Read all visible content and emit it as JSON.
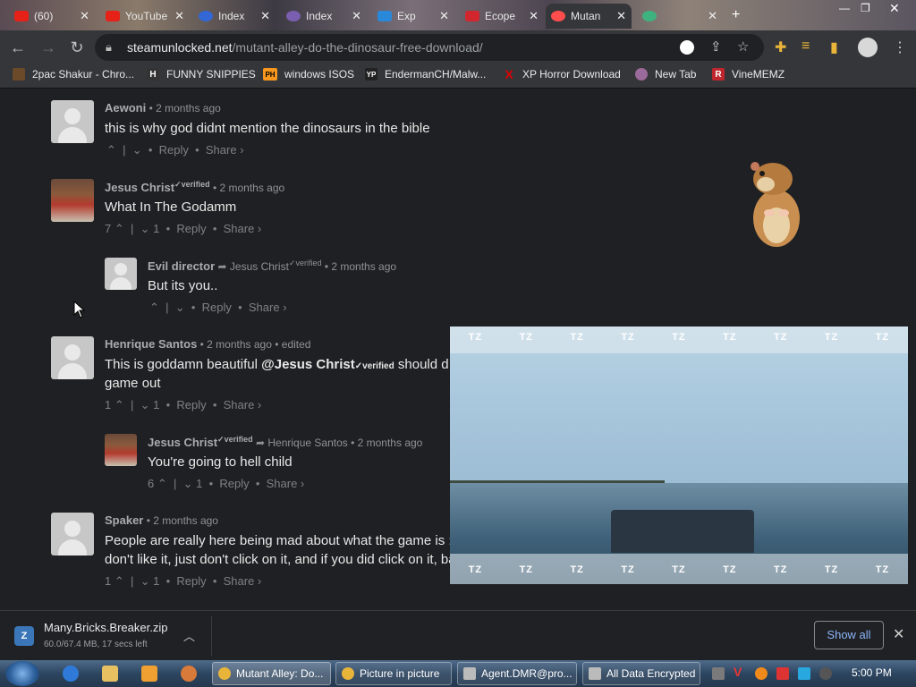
{
  "browser": {
    "tabs": [
      {
        "title": "(60)",
        "color": "#e62117",
        "active": false
      },
      {
        "title": "YouTube",
        "color": "#e62117",
        "active": false
      },
      {
        "title": "Index",
        "color": "#3367d6",
        "active": false
      },
      {
        "title": "Index",
        "color": "#7a5fb0",
        "active": false
      },
      {
        "title": "Exp",
        "color": "#2a88d8",
        "active": false
      },
      {
        "title": "Ecope",
        "color": "#d2262e",
        "active": false
      },
      {
        "title": "Mutan",
        "color": "#ff4d4d",
        "active": true
      }
    ],
    "url_host": "steamunlocked.net",
    "url_path": "/mutant-alley-do-the-dinosaur-free-download/",
    "bookmarks": [
      {
        "label": "2pac Shakur - Chro...",
        "icon": "tupac-icon",
        "color": "#6b4a2a",
        "glyph": ""
      },
      {
        "label": "FUNNY SNIPPIES",
        "icon": "h-icon",
        "color": "#333333",
        "glyph": "H"
      },
      {
        "label": "windows ISOS",
        "icon": "ph-icon",
        "color": "#f7971d",
        "glyph": "PH"
      },
      {
        "label": "EndermanCH/Malw...",
        "icon": "yp-icon",
        "color": "#222222",
        "glyph": "YP"
      },
      {
        "label": "XP Horror Download",
        "icon": "x-icon",
        "color": "#d00000",
        "glyph": "X"
      },
      {
        "label": "New Tab",
        "icon": "newtab-icon",
        "color": "#9a6a9a",
        "glyph": ""
      },
      {
        "label": "VineMEMZ",
        "icon": "vine-icon",
        "color": "#c0262d",
        "glyph": "R"
      }
    ]
  },
  "comments": [
    {
      "author": "Aewoni",
      "verified": "",
      "reply_to": "",
      "reply_verified": "",
      "time": "2 months ago",
      "edited": "",
      "text": "this is why god didnt mention the dinosaurs in the bible",
      "text2": "",
      "up": "",
      "down": "",
      "reply": "Reply",
      "share": "Share ›",
      "avatar": "default"
    },
    {
      "author": "Jesus Christ",
      "verified": "✓verified",
      "reply_to": "",
      "reply_verified": "",
      "time": "2 months ago",
      "edited": "",
      "text": "What In The Godamm",
      "text2": "",
      "up": "7",
      "down": "1",
      "reply": "Reply",
      "share": "Share ›",
      "avatar": "jesus"
    },
    {
      "author": "Evil director",
      "verified": "",
      "reply_to": "Jesus Christ",
      "reply_verified": "✓verified",
      "time": "2 months ago",
      "edited": "",
      "text": "But its you..",
      "text2": "",
      "up": "",
      "down": "",
      "reply": "Reply",
      "share": "Share ›",
      "avatar": "default"
    },
    {
      "author": "Henrique Santos",
      "verified": "",
      "reply_to": "",
      "reply_verified": "",
      "time": "2 months ago",
      "edited": "edited",
      "text_pre": "This is goddamn beautiful ",
      "mention": "@Jesus Christ",
      "mention_verified": "✓verified",
      "text_post": " should d",
      "text2": "game out",
      "up": "1",
      "down": "1",
      "reply": "Reply",
      "share": "Share ›",
      "avatar": "default"
    },
    {
      "author": "Jesus Christ",
      "verified": "✓verified",
      "reply_to": "Henrique Santos",
      "reply_verified": "",
      "time": "2 months ago",
      "edited": "",
      "text": "You're going to hell child",
      "text2": "",
      "up": "6",
      "down": "1",
      "reply": "Reply",
      "share": "Share ›",
      "avatar": "jesus"
    },
    {
      "author": "Spaker",
      "verified": "",
      "reply_to": "",
      "reply_verified": "",
      "time": "2 months ago",
      "edited": "",
      "text": "People are really here being mad about what the game is :",
      "text2": "don't like it, just don't click on it, and if you did click on it, ba",
      "up": "1",
      "down": "1",
      "reply": "Reply",
      "share": "Share ›",
      "avatar": "default"
    }
  ],
  "pip": {
    "watermark": "TZ"
  },
  "download": {
    "filename": "Many.Bricks.Breaker.zip",
    "status": "60.0/67.4 MB, 17 secs left",
    "show_all": "Show all",
    "progress": 0.89
  },
  "taskbar": {
    "tasks": [
      {
        "label": "Mutant Alley: Do...",
        "icon_color": "#e9b43a",
        "active": true
      },
      {
        "label": "Picture in picture",
        "icon_color": "#e9b43a",
        "active": false
      },
      {
        "label": "Agent.DMR@pro...",
        "icon_color": "#bbbbbb",
        "active": false
      },
      {
        "label": "All Data Encrypted",
        "icon_color": "#bbbbbb",
        "active": false
      }
    ],
    "clock": "5:00 PM"
  }
}
